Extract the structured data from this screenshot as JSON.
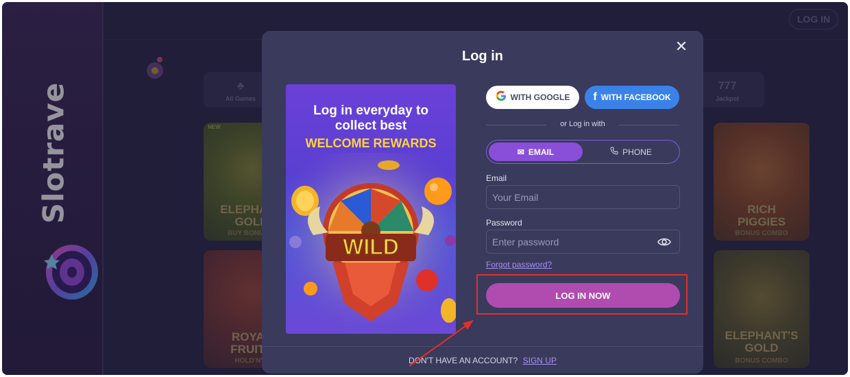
{
  "brand": {
    "name": "Slotrave"
  },
  "background": {
    "login_button": "LOG IN",
    "categories": [
      {
        "label": "All Games",
        "glyph": "♣"
      },
      {
        "label": "Jackpot",
        "glyph": "777"
      }
    ],
    "tiles": [
      {
        "badge": "NEW",
        "title": "ELEPHANT\nGOLD",
        "subtitle": "BUY BONUS C"
      },
      {
        "title": "RICH\nPIGGIES",
        "subtitle": "BONUS COMBO"
      },
      {
        "title": "ROYAL\nFRUITS",
        "subtitle": "HOLD'N'LI"
      },
      {
        "title": "ELEPHANT'S\nGOLD",
        "subtitle": "BONUS COMBO"
      }
    ]
  },
  "modal": {
    "title": "Log in",
    "close_label": "✕",
    "promo": {
      "line1": "Log in everyday to",
      "line2": "collect best",
      "line3": "WELCOME REWARDS",
      "art_text": "WILD"
    },
    "social": {
      "google_label": "WITH GOOGLE",
      "facebook_label": "WITH FACEBOOK"
    },
    "divider_text": "or Log in with",
    "tabs": {
      "email": "EMAIL",
      "phone": "PHONE",
      "active": "email"
    },
    "email_label": "Email",
    "email_placeholder": "Your Email",
    "password_label": "Password",
    "password_placeholder": "Enter password",
    "forgot_password": "Forgot password?",
    "submit_label": "LOG IN NOW",
    "footer_question": "DON'T HAVE AN ACCOUNT?",
    "footer_link": "SIGN UP"
  },
  "colors": {
    "accent_purple": "#8a4fd9",
    "submit": "#b04bb0",
    "facebook": "#3b82e8",
    "annotation_red": "#e0302a"
  }
}
